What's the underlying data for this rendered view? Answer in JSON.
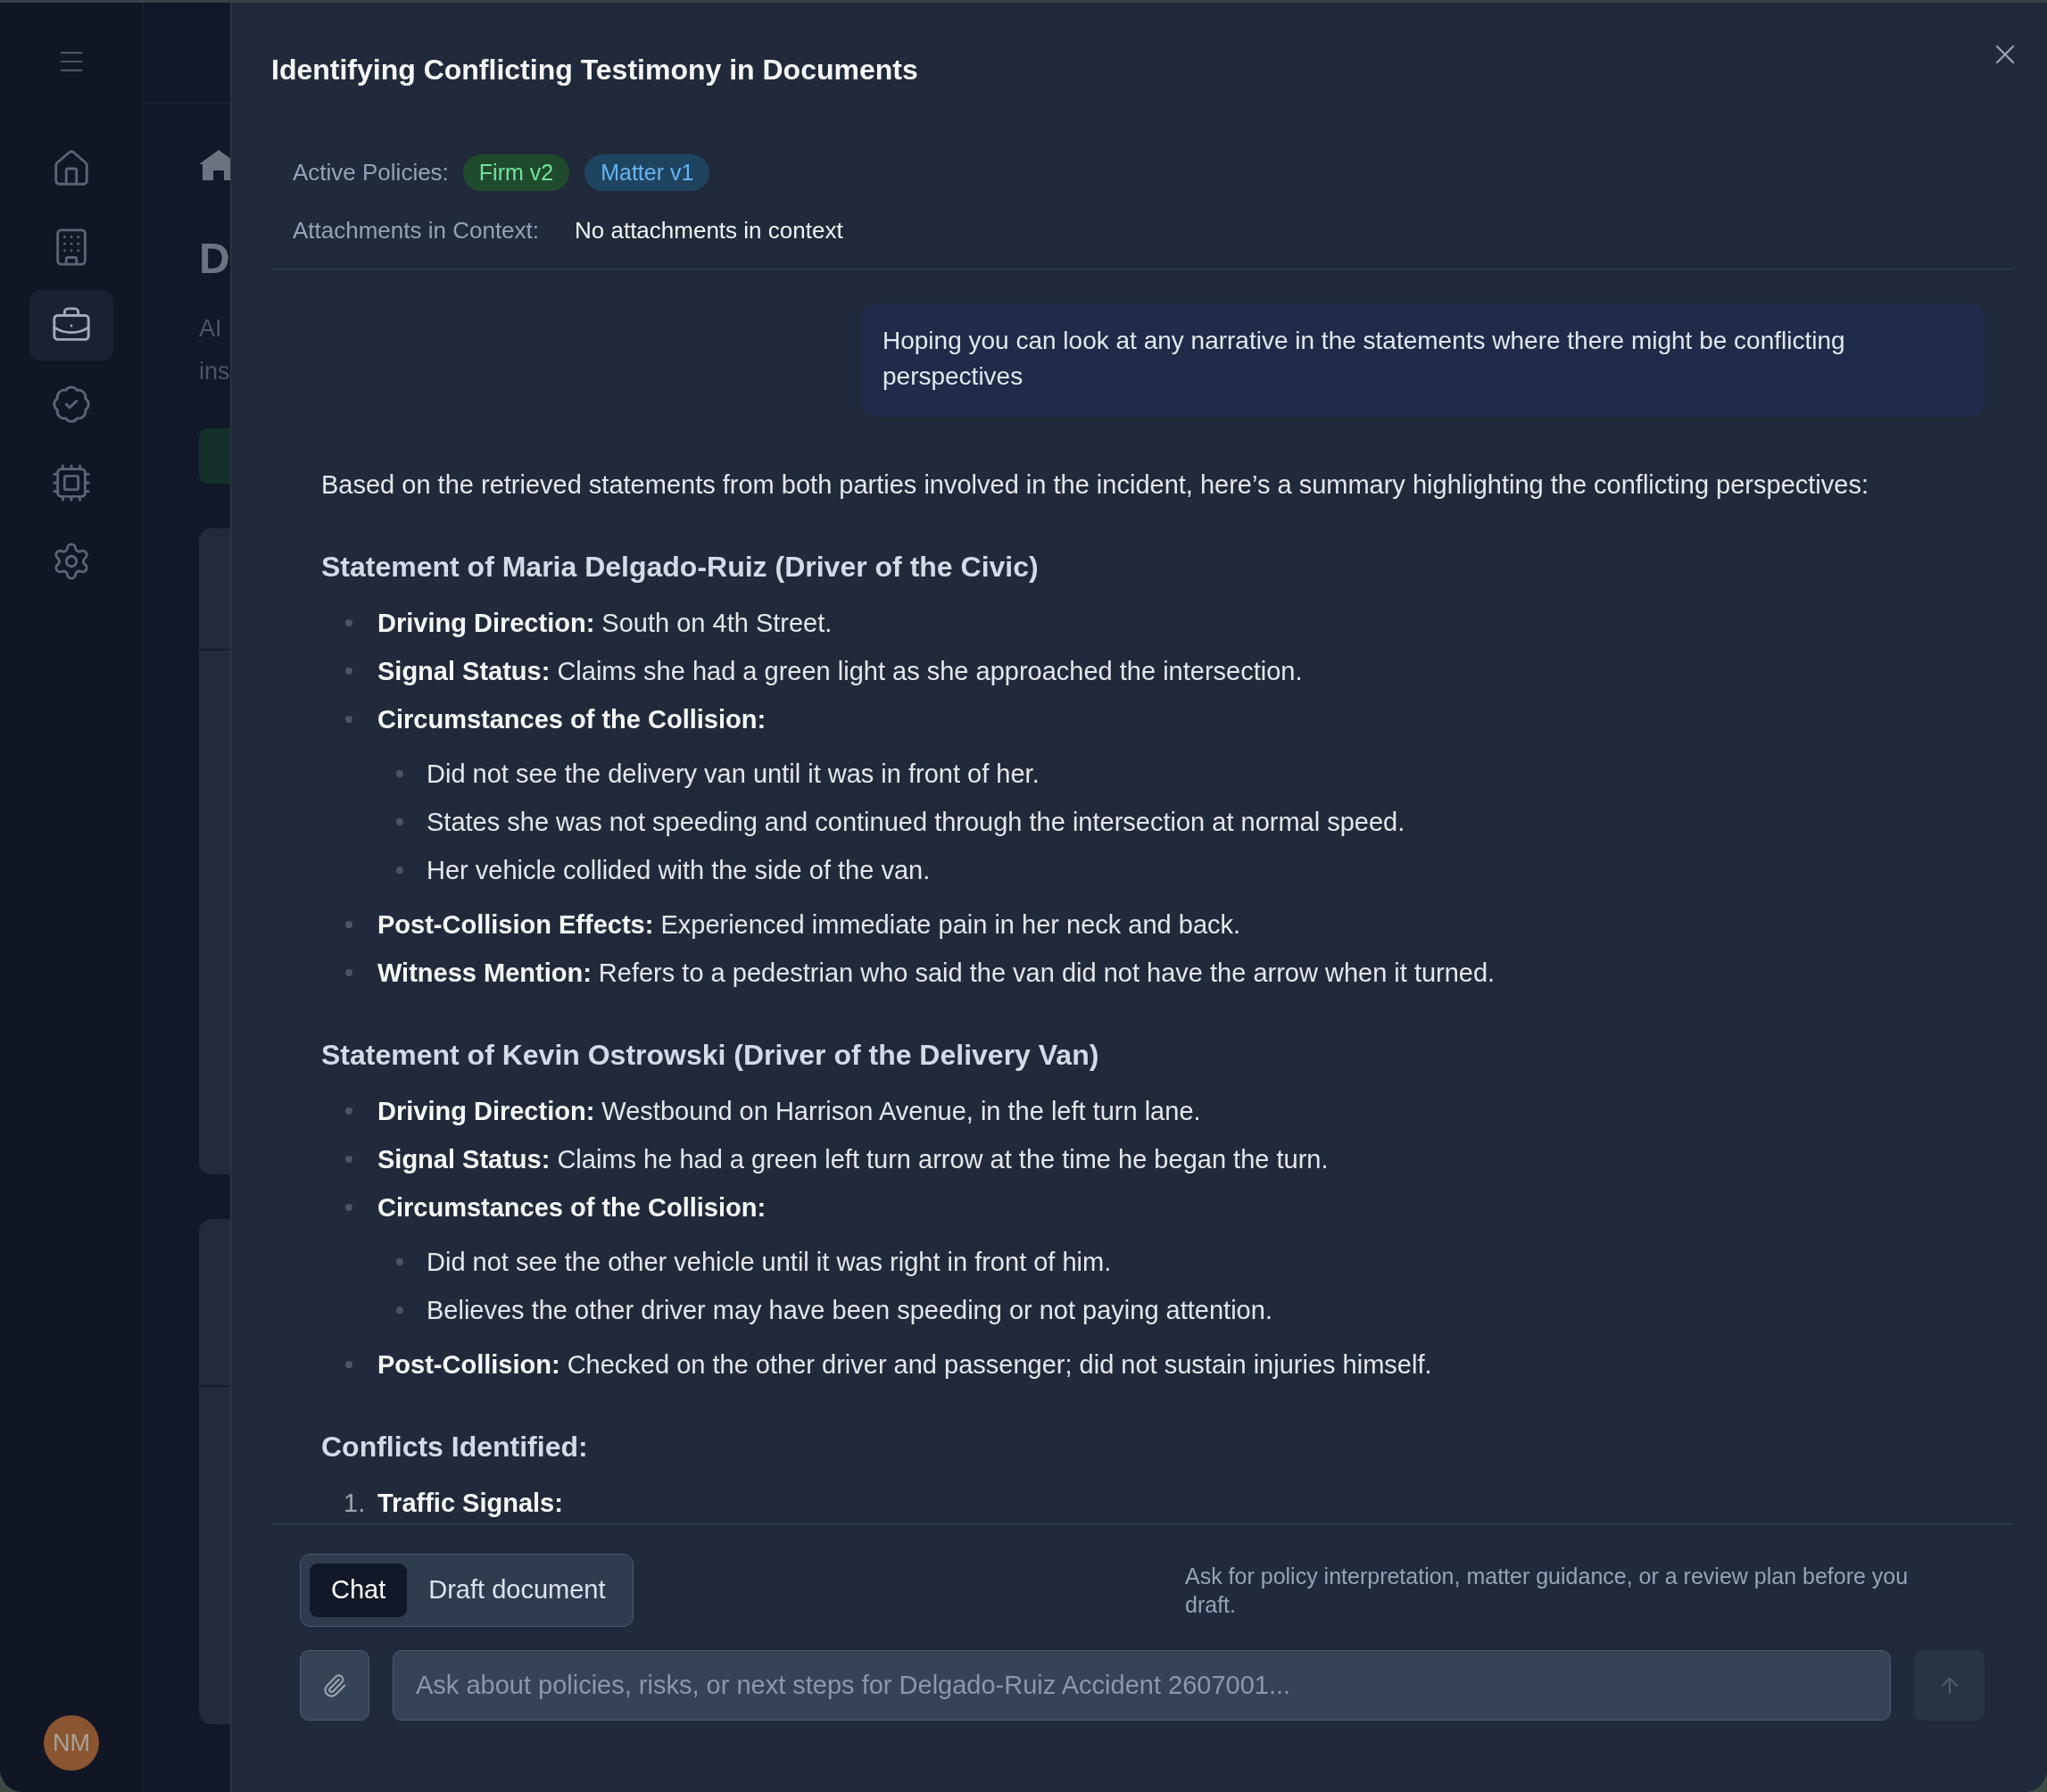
{
  "sidebar": {
    "items": [
      {
        "selected": false
      },
      {
        "selected": false
      },
      {
        "selected": true
      },
      {
        "selected": false
      },
      {
        "selected": false
      },
      {
        "selected": false
      }
    ],
    "avatar": {
      "initials": "NM"
    }
  },
  "background_page": {
    "title": "D",
    "subtitle_lines": [
      "AI",
      "ins"
    ]
  },
  "dialog": {
    "title": "Identifying Conflicting Testimony in Documents",
    "context": {
      "policies_label": "Active Policies:",
      "policies": [
        {
          "label": "Firm v2",
          "color": "#1f4a2e"
        },
        {
          "label": "Matter v1",
          "color": "#1f4460"
        }
      ],
      "attachments_label": "Attachments in Context:",
      "attachments_value": "No attachments in context"
    },
    "messages": [
      {
        "kind": "user",
        "text": "Hoping you can look at any narrative in the statements where there might be conflicting perspectives"
      },
      {
        "kind": "assistant",
        "blocks": [
          {
            "kind": "paragraph",
            "text": "Based on the retrieved statements from both parties involved in the incident, here’s a summary highlighting the conflicting perspectives:"
          },
          {
            "kind": "heading",
            "text": "Statement of Maria Delgado-Ruiz (Driver of the Civic)"
          },
          {
            "kind": "bullet_list",
            "items": [
              {
                "text": "**Driving Direction:** South on 4th Street."
              },
              {
                "text": "**Signal Status:** Claims she had a green light as she approached the intersection."
              },
              {
                "text": "**Circumstances of the Collision:**",
                "children": [
                  {
                    "text": "Did not see the delivery van until it was in front of her."
                  },
                  {
                    "text": "States she was not speeding and continued through the intersection at normal speed."
                  },
                  {
                    "text": "Her vehicle collided with the side of the van."
                  }
                ]
              },
              {
                "text": "**Post-Collision Effects:** Experienced immediate pain in her neck and back."
              },
              {
                "text": "**Witness Mention:** Refers to a pedestrian who said the van did not have the arrow when it turned."
              }
            ]
          },
          {
            "kind": "heading",
            "text": "Statement of Kevin Ostrowski (Driver of the Delivery Van)"
          },
          {
            "kind": "bullet_list",
            "items": [
              {
                "text": "**Driving Direction:** Westbound on Harrison Avenue, in the left turn lane."
              },
              {
                "text": "**Signal Status:** Claims he had a green left turn arrow at the time he began the turn."
              },
              {
                "text": "**Circumstances of the Collision:**",
                "children": [
                  {
                    "text": "Did not see the other vehicle until it was right in front of him."
                  },
                  {
                    "text": "Believes the other driver may have been speeding or not paying attention."
                  }
                ]
              },
              {
                "text": "**Post-Collision:** Checked on the other driver and passenger; did not sustain injuries himself."
              }
            ]
          },
          {
            "kind": "heading",
            "text": "Conflicts Identified:"
          },
          {
            "kind": "numbered_list",
            "items": [
              {
                "number": "1.",
                "text": "**Traffic Signals:**"
              }
            ]
          }
        ]
      }
    ],
    "composer": {
      "modes": [
        {
          "label": "Chat",
          "selected": true
        },
        {
          "label": "Draft document",
          "selected": false
        }
      ],
      "hint": "Ask for policy interpretation, matter guidance, or a review plan before you draft.",
      "input": {
        "placeholder": "Ask about policies, risks, or next steps for Delgado-Ruiz Accident 2607001..."
      },
      "send_button": {
        "disabled": true
      }
    }
  }
}
